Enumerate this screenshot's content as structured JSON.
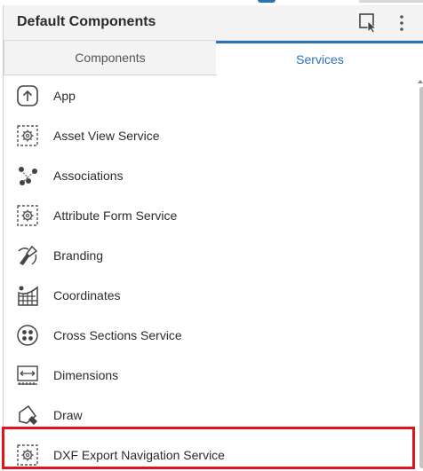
{
  "header": {
    "title": "Default Components"
  },
  "tabs": [
    {
      "label": "Components",
      "active": false
    },
    {
      "label": "Services",
      "active": true
    }
  ],
  "items": [
    {
      "label": "App",
      "icon": "app-icon"
    },
    {
      "label": "Asset View Service",
      "icon": "service-gear-icon"
    },
    {
      "label": "Associations",
      "icon": "associations-icon"
    },
    {
      "label": "Attribute Form Service",
      "icon": "service-gear-icon"
    },
    {
      "label": "Branding",
      "icon": "branding-icon"
    },
    {
      "label": "Coordinates",
      "icon": "coordinates-icon"
    },
    {
      "label": "Cross Sections Service",
      "icon": "cross-sections-icon"
    },
    {
      "label": "Dimensions",
      "icon": "dimensions-icon"
    },
    {
      "label": "Draw",
      "icon": "draw-icon"
    },
    {
      "label": "DXF Export Navigation Service",
      "icon": "service-gear-icon"
    }
  ],
  "colors": {
    "accent": "#2b72b9",
    "highlight": "#e0141b"
  }
}
